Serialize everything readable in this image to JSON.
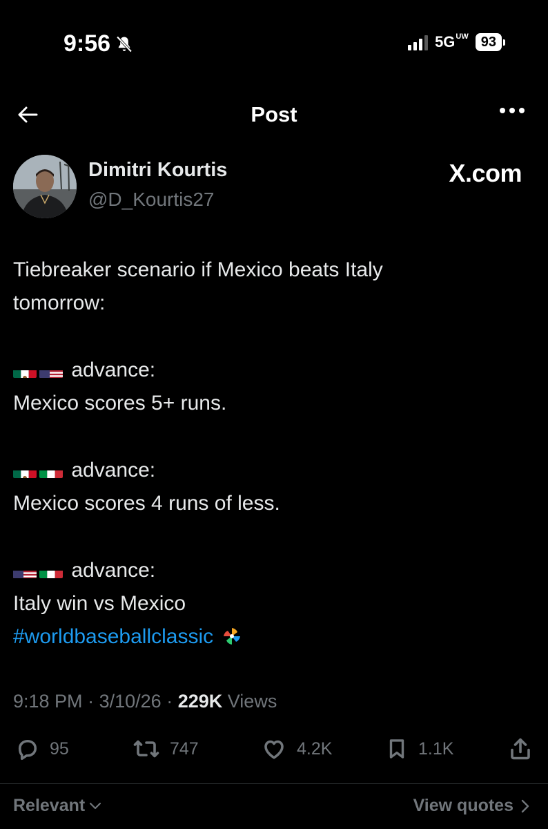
{
  "status_bar": {
    "time": "9:56",
    "network": "5G",
    "network_super": "UW",
    "battery": "93"
  },
  "nav": {
    "title": "Post"
  },
  "author": {
    "name": "Dimitri Kourtis",
    "handle": "@D_Kourtis27",
    "brand": "X.com"
  },
  "tweet": {
    "line1": "Tiebreaker scenario if Mexico beats Italy",
    "line2": "tomorrow:",
    "scenarios": [
      {
        "flags": [
          "mexico",
          "usa"
        ],
        "label": "advance:",
        "detail": "Mexico scores 5+ runs."
      },
      {
        "flags": [
          "mexico",
          "italy"
        ],
        "label": "advance:",
        "detail": "Mexico scores 4 runs of less."
      },
      {
        "flags": [
          "usa",
          "italy"
        ],
        "label": "advance:",
        "detail": "Italy win vs Mexico"
      }
    ],
    "hashtag": "#worldbaseballclassic"
  },
  "meta": {
    "time": "9:18 PM",
    "sep1": "·",
    "date": "3/10/26",
    "sep2": "·",
    "views_count": "229K",
    "views_label": "Views"
  },
  "actions": {
    "replies": "95",
    "reposts": "747",
    "likes": "4.2K",
    "bookmarks": "1.1K"
  },
  "footer": {
    "sort_label": "Relevant",
    "view_quotes": "View quotes"
  },
  "colors": {
    "background": "#000000",
    "text": "#e7e9ea",
    "muted": "#71767b",
    "link": "#1d9bf0"
  }
}
